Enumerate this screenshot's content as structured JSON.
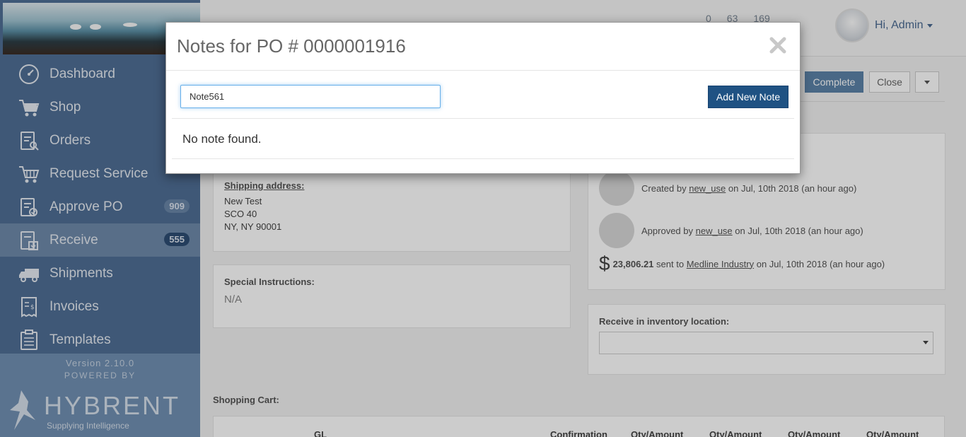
{
  "sidebar": {
    "version": "Version 2.10.0",
    "powered_by": "POWERED BY",
    "brand_name": "HYBRENT",
    "brand_tagline": "Supplying Intelligence",
    "items": [
      {
        "label": "Dashboard",
        "icon": "dashboard-icon"
      },
      {
        "label": "Shop",
        "icon": "cart-icon"
      },
      {
        "label": "Orders",
        "icon": "orders-icon"
      },
      {
        "label": "Request Service",
        "icon": "request-service-icon"
      },
      {
        "label": "Approve PO",
        "icon": "approve-po-icon",
        "badge": "909"
      },
      {
        "label": "Receive",
        "icon": "receive-icon",
        "badge": "555",
        "active": true
      },
      {
        "label": "Shipments",
        "icon": "truck-icon"
      },
      {
        "label": "Invoices",
        "icon": "invoice-icon"
      },
      {
        "label": "Templates",
        "icon": "templates-icon"
      }
    ]
  },
  "header": {
    "counters": [
      "0",
      "63",
      "169"
    ],
    "user_greeting": "Hi, Admin"
  },
  "main": {
    "complete_label": "Complete",
    "close_label": "Close",
    "shipping_label": "Shipping address:",
    "shipping_lines": [
      "New Test",
      "SCO 40",
      "NY, NY 90001"
    ],
    "special_label": "Special Instructions:",
    "special_value": "N/A",
    "activity": {
      "created_prefix": "Created by",
      "created_user": "new_use",
      "created_suffix": "on Jul, 10th 2018 (an hour ago)",
      "approved_prefix": "Approved by",
      "approved_user": "new_use",
      "approved_suffix": "on Jul, 10th 2018 (an hour ago)",
      "amount": "23,806.21",
      "sent_to": "sent to",
      "vendor": "Medline Industry",
      "sent_suffix": "on Jul, 10th 2018 (an hour ago)"
    },
    "inventory_label": "Receive in inventory location:",
    "cart_label": "Shopping Cart:",
    "cart_headers": [
      "GL",
      "Confirmation",
      "Qty/Amount",
      "Qty/Amount",
      "Qty/Amount",
      "Qty/Amount"
    ]
  },
  "modal": {
    "title": "Notes for PO # 0000001916",
    "input_value": "Note561",
    "add_button": "Add New Note",
    "empty_message": "No note found."
  }
}
